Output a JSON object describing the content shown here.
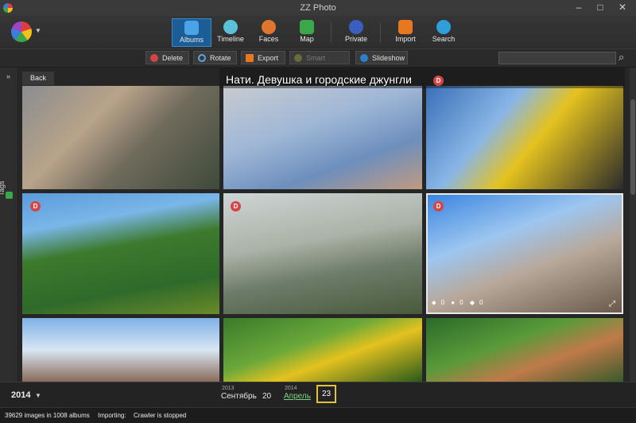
{
  "window": {
    "title": "ZZ Photo"
  },
  "toolbar": {
    "items": [
      {
        "label": "Albums",
        "active": true,
        "icon": "albums-icon"
      },
      {
        "label": "Timeline",
        "active": false,
        "icon": "clock-icon"
      },
      {
        "label": "Faces",
        "active": false,
        "icon": "face-icon"
      },
      {
        "label": "Map",
        "active": false,
        "icon": "map-pin-icon"
      },
      {
        "label": "Private",
        "active": false,
        "icon": "shield-icon"
      },
      {
        "label": "Import",
        "active": false,
        "icon": "import-icon"
      },
      {
        "label": "Search",
        "active": false,
        "icon": "search-icon"
      }
    ]
  },
  "actions": {
    "delete": "Delete",
    "rotate": "Rotate",
    "export": "Export",
    "smart_album": "Smart album",
    "slideshow": "Slideshow"
  },
  "sidebar": {
    "tags_label": "Tags"
  },
  "album": {
    "back_label": "Back",
    "title": "Нати. Девушка и городские джунгли"
  },
  "photos": [
    {
      "badge": ""
    },
    {
      "badge": ""
    },
    {
      "badge": "D"
    },
    {
      "badge": "D"
    },
    {
      "badge": "D"
    },
    {
      "badge": "D"
    },
    {
      "badge": ""
    },
    {
      "badge": ""
    },
    {
      "badge": ""
    }
  ],
  "selected_photo_stats": {
    "tags": "0",
    "faces": "0",
    "places": "0"
  },
  "timeline": {
    "year": "2014",
    "entries": [
      {
        "year": "2013",
        "month": "Сентябрь",
        "day": "20"
      },
      {
        "year": "2014",
        "month": "Апрель",
        "day": "23"
      }
    ]
  },
  "status": {
    "summary": "39629 images in 1008 albums",
    "importing_label": "Importing:",
    "crawler": "Crawler is stopped"
  },
  "colors": {
    "accent": "#1c5d96",
    "badge": "#d64545",
    "selected_day": "#e6c23a"
  }
}
